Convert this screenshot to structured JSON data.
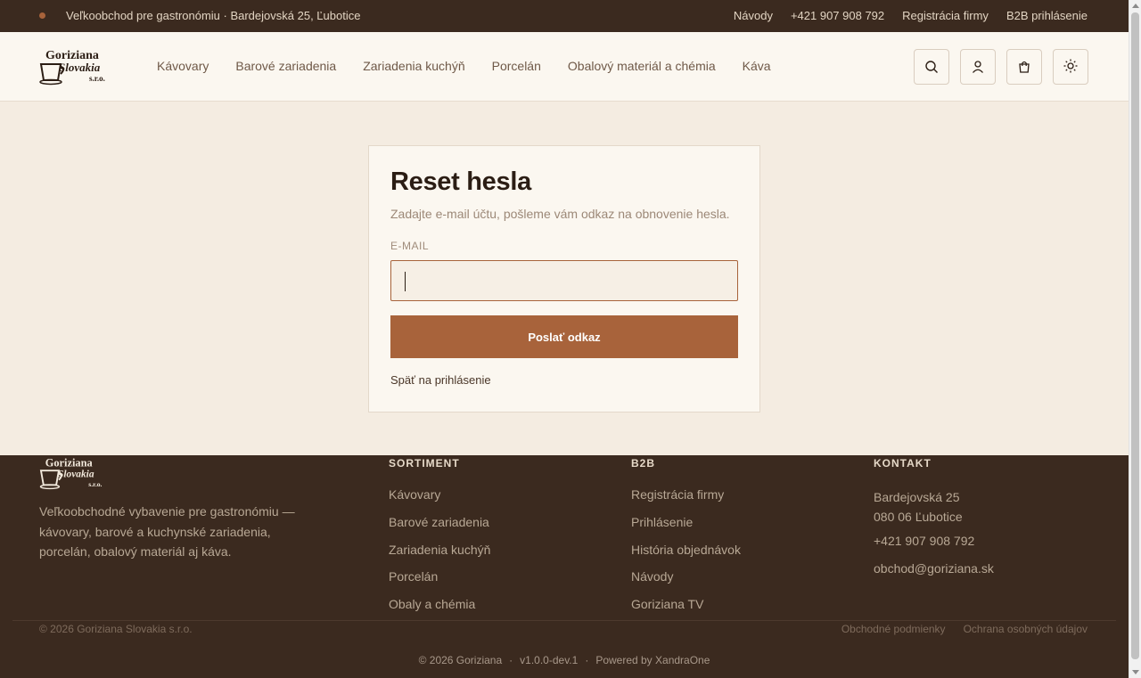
{
  "topbar": {
    "tagline": "Veľkoobchod pre gastronómiu · Bardejovská 25, Ľubotice",
    "links": [
      "Návody",
      "+421 907 908 792",
      "Registrácia firmy",
      "B2B prihlásenie"
    ]
  },
  "header": {
    "logo_text": [
      "Goriziana",
      "Slovakia",
      "s.r.o."
    ],
    "nav": [
      "Kávovary",
      "Barové zariadenia",
      "Zariadenia kuchýň",
      "Porcelán",
      "Obalový materiál a chémia",
      "Káva"
    ],
    "icons": [
      "search-icon",
      "user-icon",
      "cart-icon",
      "sun-icon"
    ]
  },
  "reset": {
    "title": "Reset hesla",
    "subtitle": "Zadajte e-mail účtu, pošleme vám odkaz na obnovenie hesla.",
    "email_label": "E-MAIL",
    "email_value": "",
    "submit_label": "Poslať odkaz",
    "back_label": "Späť na prihlásenie"
  },
  "footer": {
    "description": "Veľkoobchodné vybavenie pre gastronómiu — kávovary, barové a kuchynské zariadenia, porcelán, obalový materiál aj káva.",
    "sortiment": {
      "heading": "SORTIMENT",
      "links": [
        "Kávovary",
        "Barové zariadenia",
        "Zariadenia kuchýň",
        "Porcelán",
        "Obaly a chémia"
      ]
    },
    "b2b": {
      "heading": "B2B",
      "links": [
        "Registrácia firmy",
        "Prihlásenie",
        "História objednávok",
        "Návody",
        "Goriziana TV"
      ]
    },
    "kontakt": {
      "heading": "KONTAKT",
      "address_line1": "Bardejovská 25",
      "address_line2": "080 06 Ľubotice",
      "phone": "+421 907 908 792",
      "email": "obchod@goriziana.sk"
    },
    "copyright": "© 2026 Goriziana Slovakia s.r.o.",
    "legal": [
      "Obchodné podmienky",
      "Ochrana osobných údajov"
    ],
    "bottom": {
      "copy": "© 2026 Goriziana",
      "version": "v1.0.0-dev.1",
      "powered": "Powered by XandraOne"
    }
  },
  "colors": {
    "accent": "#a8633b",
    "dark": "#3b2a1f",
    "page_bg": "#f4ece1",
    "card_bg": "#fbf7f0"
  }
}
